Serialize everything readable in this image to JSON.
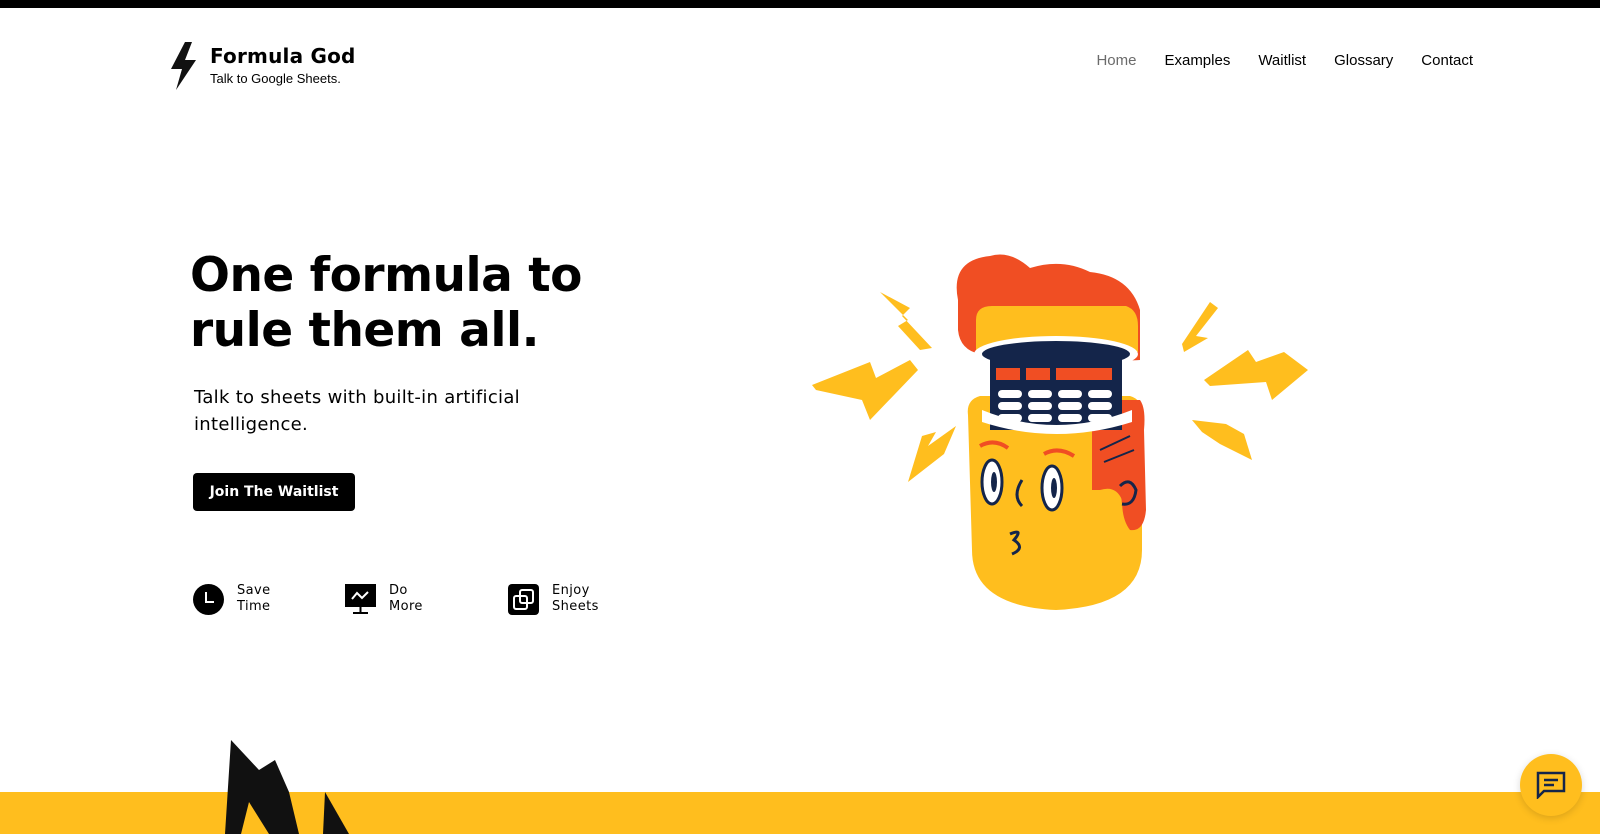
{
  "brand": {
    "name": "Formula God",
    "tagline": "Talk to Google Sheets.",
    "icon": "lightning-bolt-icon"
  },
  "nav": {
    "items": [
      {
        "label": "Home",
        "active": true
      },
      {
        "label": "Examples",
        "active": false
      },
      {
        "label": "Waitlist",
        "active": false
      },
      {
        "label": "Glossary",
        "active": false
      },
      {
        "label": "Contact",
        "active": false
      }
    ]
  },
  "hero": {
    "title": "One formula to rule them all.",
    "subtitle": "Talk to sheets with built-in artificial intelligence.",
    "cta_label": "Join The Waitlist"
  },
  "features": [
    {
      "line1": "Save",
      "line2": "Time",
      "icon": "clock-icon"
    },
    {
      "line1": "Do",
      "line2": "More",
      "icon": "presentation-chart-icon"
    },
    {
      "line1": "Enjoy",
      "line2": "Sheets",
      "icon": "overlapping-squares-icon"
    }
  ],
  "chat": {
    "icon": "chat-icon"
  },
  "colors": {
    "accent_yellow": "#FFBE1E",
    "accent_orange": "#F04E23",
    "navy": "#14254A",
    "text": "#000000",
    "nav_active": "#6b6b6b"
  }
}
